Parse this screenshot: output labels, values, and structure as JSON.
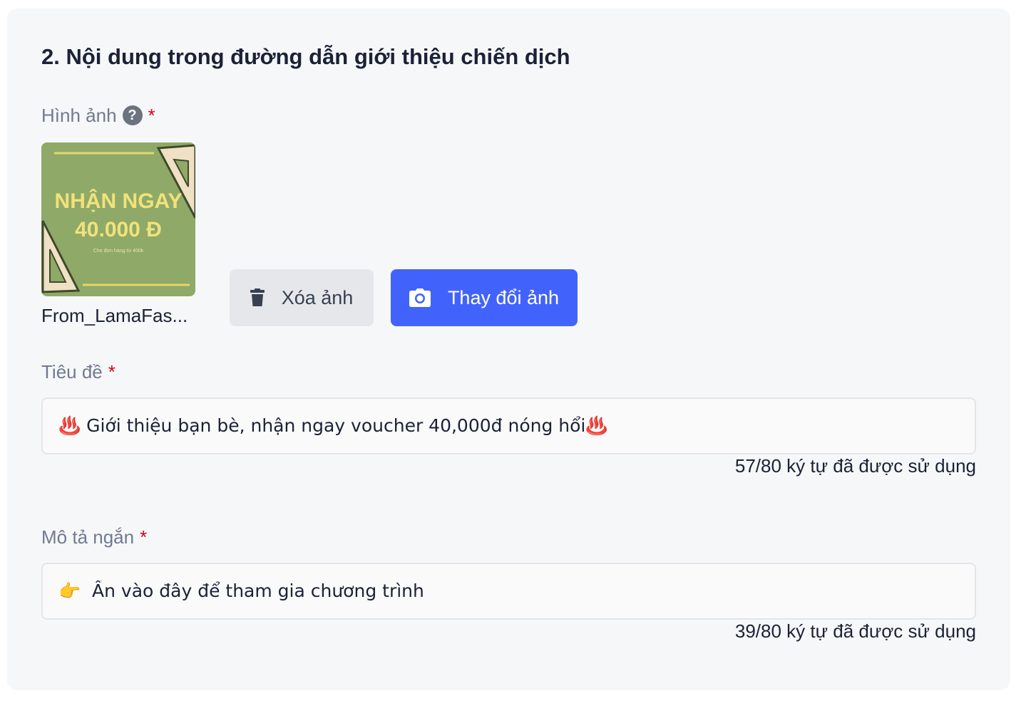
{
  "section": {
    "title": "2. Nội dung trong đường dẫn giới thiệu chiến dịch"
  },
  "image_field": {
    "label": "Hình ảnh",
    "help_icon": "?",
    "required_mark": "*",
    "thumbnail": {
      "line1": "NHẬN NGAY",
      "line2": "40.000 Đ",
      "caption": "Cho đơn hàng từ 400k",
      "background_color": "#8fa968"
    },
    "filename": "From_LamaFas...",
    "delete_button": {
      "label": "Xóa ảnh",
      "icon": "trash-icon"
    },
    "change_button": {
      "label": "Thay đổi ảnh",
      "icon": "camera-icon"
    }
  },
  "title_field": {
    "label": "Tiêu đề",
    "required_mark": "*",
    "value": "♨️ Giới thiệu bạn bè, nhận ngay voucher 40,000đ nóng hổi♨️",
    "counter": "57/80 ký tự đã được sử dụng"
  },
  "description_field": {
    "label": "Mô tả ngắn",
    "required_mark": "*",
    "value": "👉  Ấn vào đây để tham gia chương trình",
    "counter": "39/80 ký tự đã được sử dụng"
  },
  "colors": {
    "card_background": "#f6f7f9",
    "primary": "#4263fb",
    "required": "#d0021b",
    "label": "#707a8f"
  }
}
